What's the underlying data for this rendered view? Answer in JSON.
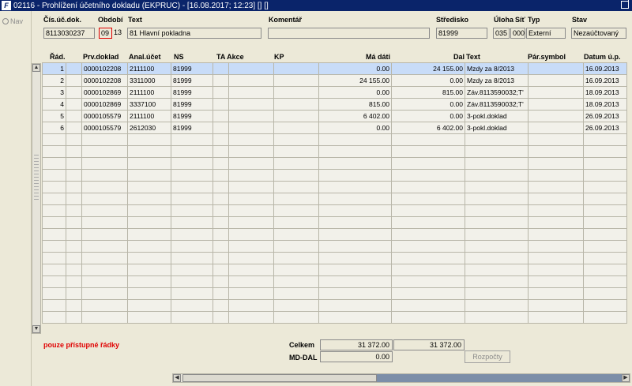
{
  "window": {
    "title": "02116 - Prohlížení účetního dokladu (EKPRUC) - [16.08.2017; 12:23] [] []",
    "logo": "F"
  },
  "sidebar": {
    "nav_label": "Nav"
  },
  "header": {
    "labels": {
      "cis_uc_dok": "Čís.úč.dok.",
      "obdobi": "Období",
      "text": "Text",
      "komentar": "Komentář",
      "stredisko": "Středisko",
      "uloha": "Úloha",
      "sit": "Síť",
      "typ": "Typ",
      "stav": "Stav"
    },
    "values": {
      "cis_uc_dok": "8113030237",
      "obdobi_month": "09",
      "obdobi_year": "13",
      "text": "81 Hlavní pokladna",
      "komentar": "",
      "stredisko": "81999",
      "uloha": "035",
      "sit": "000",
      "typ": "Externí",
      "stav": "Nezaúčtovaný"
    }
  },
  "grid": {
    "columns": {
      "rad": "Řád.",
      "prv_doklad": "Prv.doklad",
      "anal_ucet": "Anal.účet",
      "ns": "NS",
      "ta_akce": "TA Akce",
      "kp": "KP",
      "ma_dati": "Má dáti",
      "dal": "Dal",
      "text": "Text",
      "par_symbol": "Pár.symbol",
      "datum_up": "Datum ú.p."
    },
    "rows": [
      {
        "rad": "1",
        "prv_doklad": "0000102208",
        "anal_ucet": "2111100",
        "ns": "81999",
        "ma_dati": "0.00",
        "dal": "24 155.00",
        "text": "Mzdy za 8/2013",
        "par_symbol": "",
        "datum_up": "16.09.2013"
      },
      {
        "rad": "2",
        "prv_doklad": "0000102208",
        "anal_ucet": "3311000",
        "ns": "81999",
        "ma_dati": "24 155.00",
        "dal": "0.00",
        "text": "Mzdy za 8/2013",
        "par_symbol": "",
        "datum_up": "16.09.2013"
      },
      {
        "rad": "3",
        "prv_doklad": "0000102869",
        "anal_ucet": "2111100",
        "ns": "81999",
        "ma_dati": "0.00",
        "dal": "815.00",
        "text": "Záv.8113590032;T'",
        "par_symbol": "",
        "datum_up": "18.09.2013"
      },
      {
        "rad": "4",
        "prv_doklad": "0000102869",
        "anal_ucet": "3337100",
        "ns": "81999",
        "ma_dati": "815.00",
        "dal": "0.00",
        "text": "Záv.8113590032;T'",
        "par_symbol": "",
        "datum_up": "18.09.2013"
      },
      {
        "rad": "5",
        "prv_doklad": "0000105579",
        "anal_ucet": "2111100",
        "ns": "81999",
        "ma_dati": "6 402.00",
        "dal": "0.00",
        "text": "3-pokl.doklad",
        "par_symbol": "",
        "datum_up": "26.09.2013"
      },
      {
        "rad": "6",
        "prv_doklad": "0000105579",
        "anal_ucet": "2612030",
        "ns": "81999",
        "ma_dati": "0.00",
        "dal": "6 402.00",
        "text": "3-pokl.doklad",
        "par_symbol": "",
        "datum_up": "26.09.2013"
      }
    ],
    "empty_rows": 16
  },
  "footer": {
    "note": "pouze přístupné řádky",
    "celkem_label": "Celkem",
    "celkem_ma_dati": "31 372.00",
    "celkem_dal": "31 372.00",
    "md_dal_label": "MD-DAL",
    "md_dal_value": "0.00",
    "rozpocty_label": "Rozpočty"
  },
  "colors": {
    "titlebar": "#0a246a",
    "selected_row": "#c8dcf8",
    "note_red": "#e00000"
  },
  "icons": [
    "app-logo-icon",
    "restore-window-icon",
    "nav-icon",
    "scroll-up-icon",
    "scroll-down-icon",
    "scroll-left-icon",
    "scroll-right-icon"
  ]
}
